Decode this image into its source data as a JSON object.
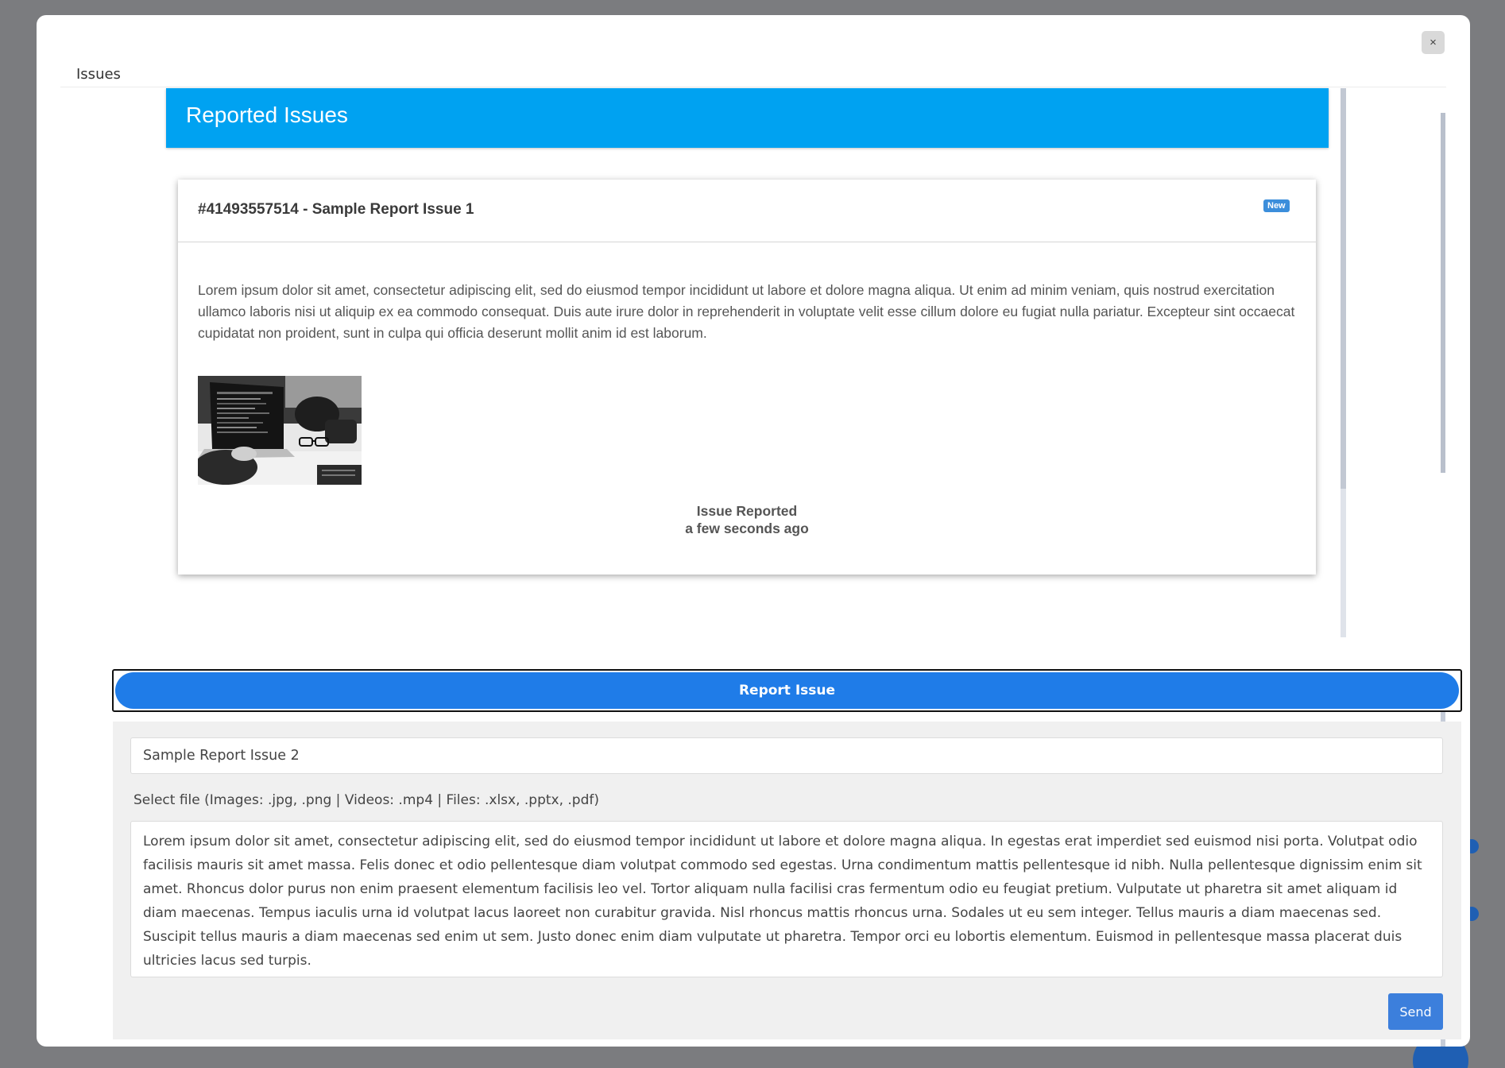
{
  "modal": {
    "title": "Issues",
    "close_label": "×"
  },
  "issues_panel": {
    "header": "Reported Issues",
    "issues": [
      {
        "title": "#41493557514 - Sample Report Issue 1",
        "badge": "New",
        "body": "Lorem ipsum dolor sit amet, consectetur adipiscing elit, sed do eiusmod tempor incididunt ut labore et dolore magna aliqua. Ut enim ad minim veniam, quis nostrud exercitation ullamco laboris nisi ut aliquip ex ea commodo consequat. Duis aute irure dolor in reprehenderit in voluptate velit esse cillum dolore eu fugiat nulla pariatur. Excepteur sint occaecat cupidatat non proident, sunt in culpa qui officia deserunt mollit anim id est laborum.",
        "status_label": "Issue Reported",
        "status_time": "a few seconds ago"
      }
    ]
  },
  "report_form": {
    "toggle_label": "Report Issue",
    "subject_value": "Sample Report Issue 2",
    "file_label": "Select file (Images: .jpg, .png | Videos: .mp4 | Files: .xlsx, .pptx, .pdf)",
    "description_value": "Lorem ipsum dolor sit amet, consectetur adipiscing elit, sed do eiusmod tempor incididunt ut labore et dolore magna aliqua. In egestas erat imperdiet sed euismod nisi porta. Volutpat odio facilisis mauris sit amet massa. Felis donec et odio pellentesque diam volutpat commodo sed egestas. Urna condimentum mattis pellentesque id nibh. Nulla pellentesque dignissim enim sit amet. Rhoncus dolor purus non enim praesent elementum facilisis leo vel. Tortor aliquam nulla facilisi cras fermentum odio eu feugiat pretium. Vulputate ut pharetra sit amet aliquam id diam maecenas. Tempus iaculis urna id volutpat lacus laoreet non curabitur gravida. Nisl rhoncus mattis rhoncus urna. Sodales ut eu sem integer. Tellus mauris a diam maecenas sed. Suscipit tellus mauris a diam maecenas sed enim ut sem. Justo donec enim diam vulputate ut pharetra. Tempor orci eu lobortis elementum. Euismod in pellentesque massa placerat duis ultricies lacus sed turpis.",
    "send_label": "Send"
  },
  "colors": {
    "header_blue": "#00a2f1",
    "report_button_blue": "#1f7ce8",
    "send_blue": "#3c7fdc",
    "badge_blue": "#3c8edb",
    "overlay": "#7b7c7f"
  }
}
